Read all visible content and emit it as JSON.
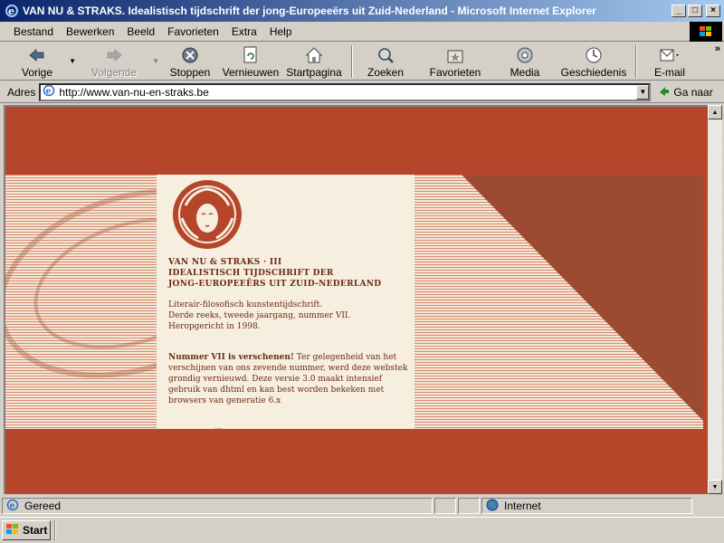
{
  "window": {
    "title": "VAN NU & STRAKS. Idealistisch tijdschrift der jong-Europeeërs uit Zuid-Nederland - Microsoft Internet Explorer"
  },
  "menu": {
    "items": [
      "Bestand",
      "Bewerken",
      "Beeld",
      "Favorieten",
      "Extra",
      "Help"
    ]
  },
  "toolbar": {
    "back": "Vorige",
    "forward": "Volgende",
    "stop": "Stoppen",
    "refresh": "Vernieuwen",
    "home": "Startpagina",
    "search": "Zoeken",
    "favorites": "Favorieten",
    "media": "Media",
    "history": "Geschiedenis",
    "mail": "E-mail"
  },
  "address": {
    "label": "Adres",
    "url": "http://www.van-nu-en-straks.be",
    "go": "Ga naar"
  },
  "page": {
    "title_line1": "VAN NU & STRAKS · III",
    "title_line2": "IDEALISTISCH TIJDSCHRIFT DER",
    "title_line3": "JONG-EUROPEEËRS UIT ZUID-NEDERLAND",
    "desc_line1": "Literair-filosofisch kunstentijdschrift.",
    "desc_line2": "Derde reeks, tweede jaargang, nummer VII.",
    "desc_line3": "Heropgericht in 1998.",
    "news_heading": "Nummer VII is verschenen!",
    "news_body": " Ter gelegenheid van het verschijnen van ons zevende nummer, werd deze webstek grondig vernieuwd. Deze versie 3.0 maakt intensief gebruik van dhtml en kan best worden bekeken met browsers van generatie 6.x"
  },
  "status": {
    "text": "Gereed",
    "zone": "Internet"
  },
  "taskbar": {
    "start": "Start"
  },
  "colors": {
    "page_bg": "#b5462a",
    "panel_bg": "#f6efe0",
    "panel_text": "#6b2a10",
    "title_bar": "#0a246a"
  }
}
